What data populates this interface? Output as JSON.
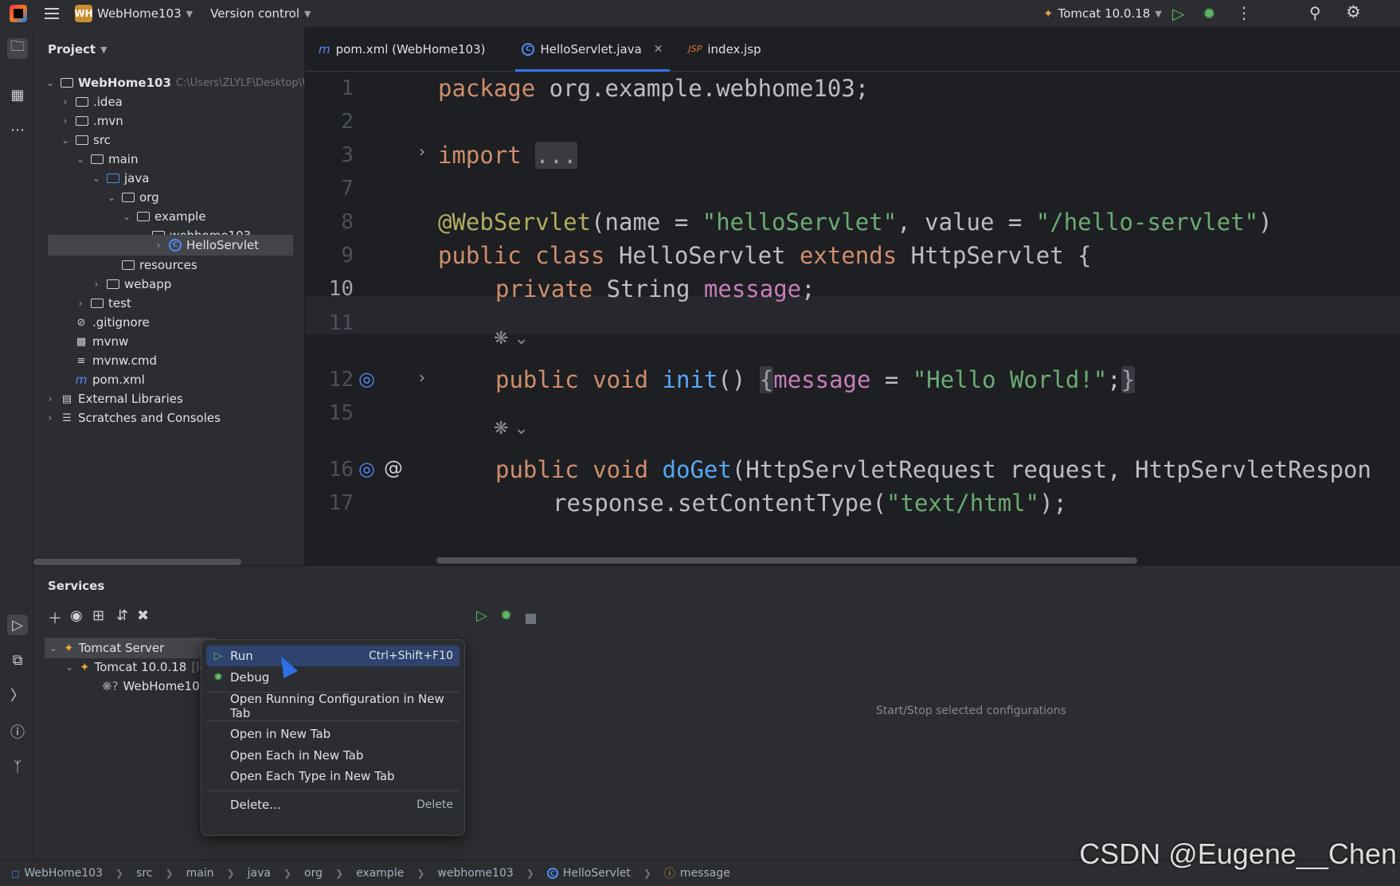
{
  "titlebar": {
    "project_badge": "WH",
    "project_name": "WebHome103",
    "vcs_label": "Version control",
    "run_config": "Tomcat 10.0.18"
  },
  "project_panel": {
    "title": "Project",
    "tree": [
      {
        "label": "WebHome103",
        "suffix": "C:\\Users\\ZLYLF\\Desktop\\W"
      },
      {
        "label": ".idea"
      },
      {
        "label": ".mvn"
      },
      {
        "label": "src"
      },
      {
        "label": "main"
      },
      {
        "label": "java"
      },
      {
        "label": "org"
      },
      {
        "label": "example"
      },
      {
        "label": "webhome103"
      },
      {
        "label": "HelloServlet"
      },
      {
        "label": "resources"
      },
      {
        "label": "webapp"
      },
      {
        "label": "test"
      },
      {
        "label": ".gitignore"
      },
      {
        "label": "mvnw"
      },
      {
        "label": "mvnw.cmd"
      },
      {
        "label": "pom.xml"
      },
      {
        "label": "External Libraries"
      },
      {
        "label": "Scratches and Consoles"
      }
    ]
  },
  "tabs": [
    {
      "icon": "m",
      "label": "pom.xml (WebHome103)"
    },
    {
      "label": "HelloServlet.java"
    },
    {
      "icon": "JSP",
      "label": "index.jsp"
    }
  ],
  "editor": {
    "line_numbers": [
      "1",
      "2",
      "3",
      "7",
      "8",
      "9",
      "10",
      "11",
      "12",
      "15",
      "16",
      "17"
    ],
    "fold_ellipsis": "...",
    "code": {
      "l1_kw": "package",
      "l1_rest": " org.example.webhome103;",
      "l3_kw": "import",
      "l8_ann": "@WebServlet",
      "l8_a": "(name = ",
      "l8_s1": "\"helloServlet\"",
      "l8_b": ", value = ",
      "l8_s2": "\"/hello-servlet\"",
      "l8_c": ")",
      "l9_kw1": "public class",
      "l9_a": " HelloServlet ",
      "l9_kw2": "extends",
      "l9_b": " HttpServlet {",
      "l10_kw": "private",
      "l10_a": " String ",
      "l10_fld": "message",
      "l10_b": ";",
      "l12_kw": "public void",
      "l12_fn": "init",
      "l12_a": "() ",
      "l12_ob": "{",
      "l12_fld": "message",
      "l12_b": " = ",
      "l12_s": "\"Hello World!\"",
      "l12_c": ";",
      "l12_cb": "}",
      "l16_kw": "public void",
      "l16_fn": "doGet",
      "l16_a": "(HttpServletRequest request, HttpServletRespon",
      "l17_a": "response.setContentType(",
      "l17_s": "\"text/html\"",
      "l17_b": ");"
    }
  },
  "services": {
    "title": "Services",
    "tree": [
      {
        "label": "Tomcat Server"
      },
      {
        "label": "Tomcat 10.0.18",
        "suffix": "[loc"
      },
      {
        "label": "WebHome10"
      }
    ],
    "hint": "Start/Stop selected configurations"
  },
  "context_menu": {
    "items": [
      {
        "label": "Run",
        "shortcut": "Ctrl+Shift+F10"
      },
      {
        "label": "Debug"
      },
      {
        "label": "Open Running Configuration in New Tab"
      },
      {
        "label": "Open in New Tab"
      },
      {
        "label": "Open Each in New Tab"
      },
      {
        "label": "Open Each Type in New Tab"
      },
      {
        "label": "Delete...",
        "shortcut": "Delete"
      }
    ]
  },
  "statusbar": {
    "crumbs": [
      "WebHome103",
      "src",
      "main",
      "java",
      "org",
      "example",
      "webhome103",
      "HelloServlet",
      "message"
    ]
  },
  "watermark": "CSDN @Eugene__Chen",
  "colors": {
    "accent": "#3574f0",
    "keyword": "#cf8e6d",
    "string": "#6aab73",
    "annotation": "#b3ae60",
    "field": "#c77dbb",
    "function": "#56a8f5"
  }
}
